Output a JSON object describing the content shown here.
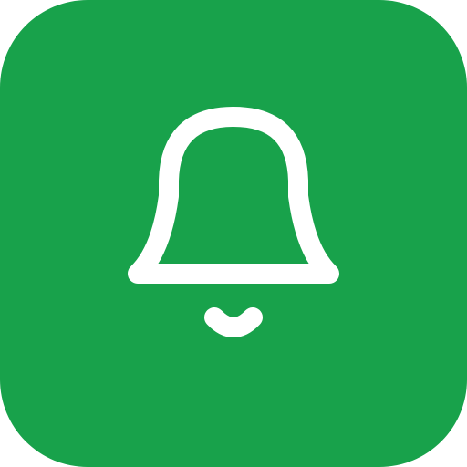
{
  "icon": {
    "name": "bell-icon",
    "background_color": "#18a24b",
    "foreground_color": "#ffffff"
  }
}
